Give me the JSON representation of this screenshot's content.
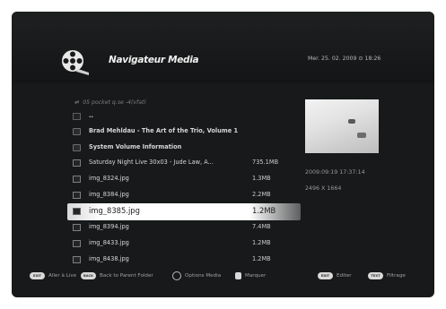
{
  "header": {
    "app_title": "Navigateur Media",
    "datetime": "Mer. 25. 02. 2009   ⊙ 18:26"
  },
  "path": "05 pocket q.se  -4(vfat)",
  "files": [
    {
      "name": "..",
      "size": "",
      "type": "parent"
    },
    {
      "name": "Brad Mehldau - The Art of the Trio, Volume 1",
      "size": "",
      "type": "folder"
    },
    {
      "name": "System Volume Information",
      "size": "",
      "type": "folder"
    },
    {
      "name": "Saturday Night Live 30x03 - Jude Law, A...",
      "size": "735.1MB",
      "type": "file"
    },
    {
      "name": "img_8324.jpg",
      "size": "1.3MB",
      "type": "file"
    },
    {
      "name": "img_8384.jpg",
      "size": "2.2MB",
      "type": "file"
    },
    {
      "name": "img_8385.jpg",
      "size": "1.2MB",
      "type": "file",
      "selected": true
    },
    {
      "name": "img_8394.jpg",
      "size": "7.4MB",
      "type": "file"
    },
    {
      "name": "img_8433.jpg",
      "size": "1.2MB",
      "type": "file"
    },
    {
      "name": "img_8438.jpg",
      "size": "1.2MB",
      "type": "file"
    }
  ],
  "preview_info": {
    "date": "2009:09:19 17:37:14",
    "resolution": "2496 X 1664"
  },
  "footer": [
    {
      "key": "EXIT",
      "label": "Aller à Live",
      "icon": "exit-key-icon"
    },
    {
      "key": "BACK",
      "label": "Back to Parent Folder",
      "icon": "back-key-icon"
    },
    {
      "key": "",
      "label": "Options Media",
      "icon": "options-key-icon"
    },
    {
      "key": "",
      "label": "Marquer",
      "icon": "mark-key-icon"
    },
    {
      "key": "EDIT",
      "label": "Editer",
      "icon": "edit-key-icon"
    },
    {
      "key": "TEXT",
      "label": "Filtrage",
      "icon": "filter-key-icon"
    }
  ]
}
